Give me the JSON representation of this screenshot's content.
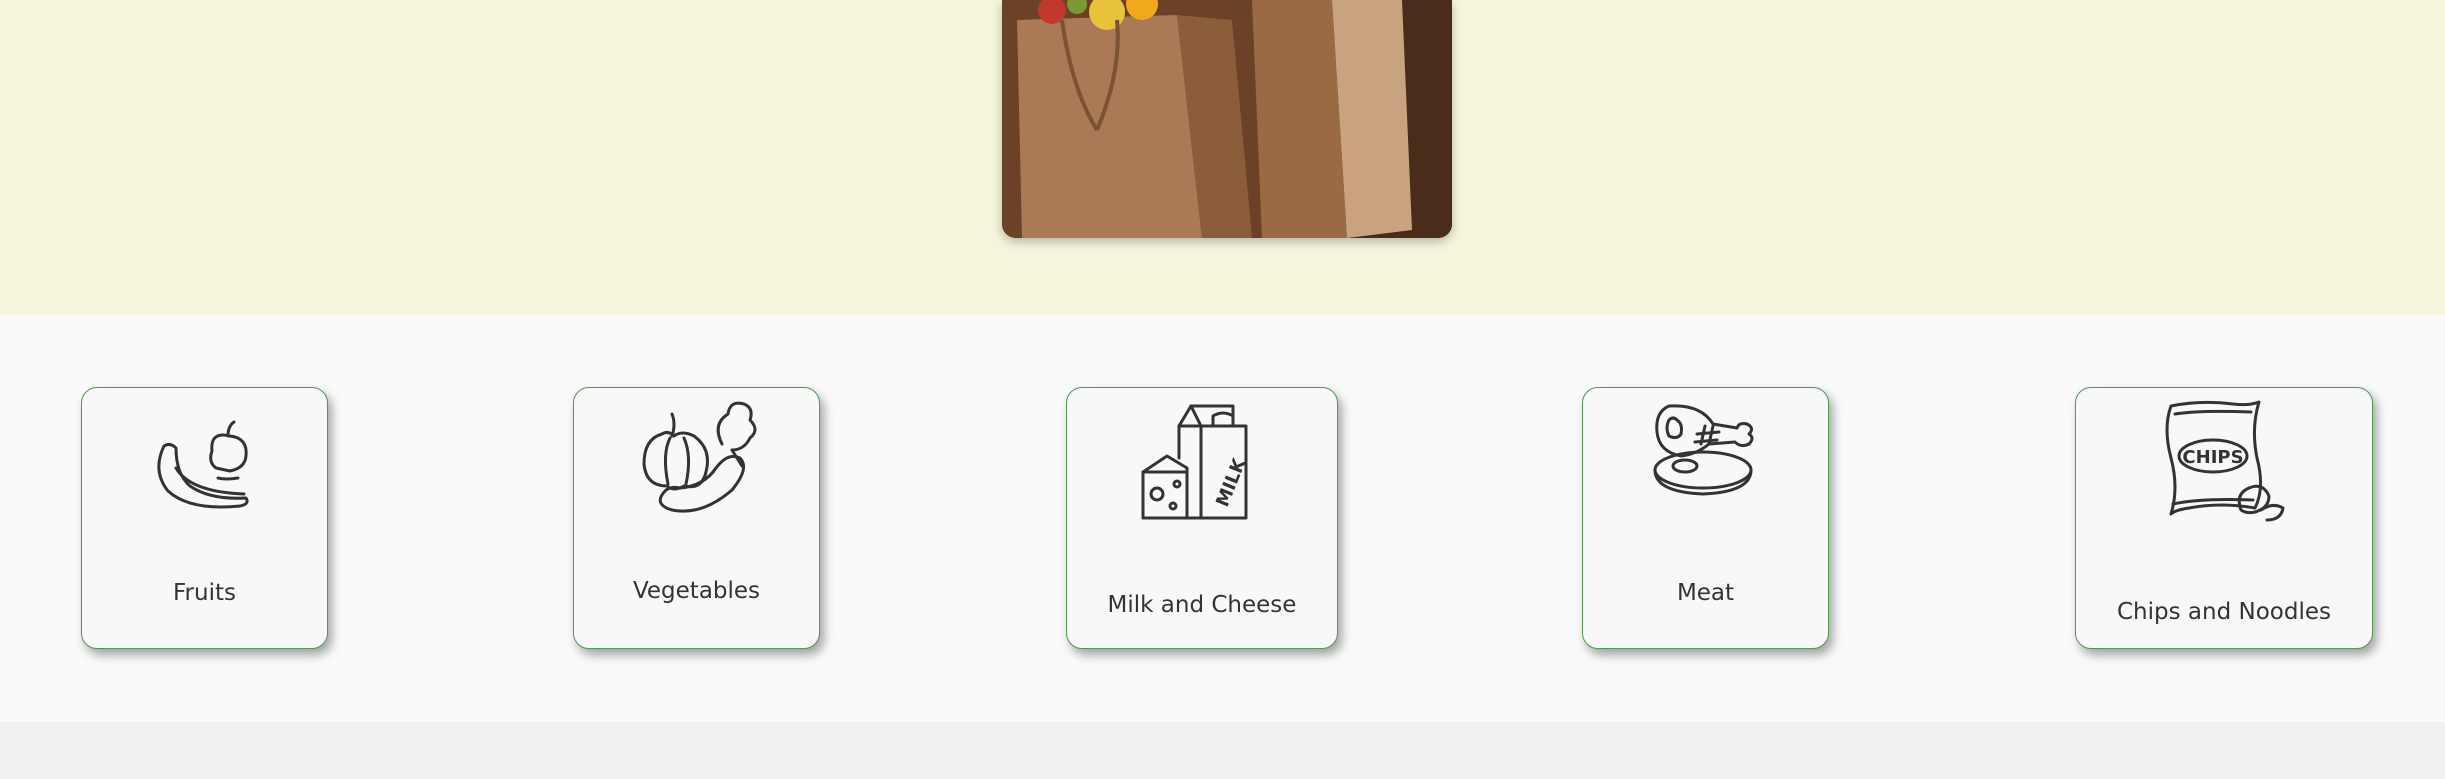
{
  "hero": {
    "image_icon": "grocery-bags-photo"
  },
  "categories": [
    {
      "label": "Fruits",
      "icon": "fruits-icon"
    },
    {
      "label": "Vegetables",
      "icon": "vegetables-icon"
    },
    {
      "label": "Milk and Cheese",
      "icon": "milk-cheese-icon"
    },
    {
      "label": "Meat",
      "icon": "meat-icon"
    },
    {
      "label": "Chips and Noodles",
      "icon": "chips-icon",
      "icon_text": "CHIPS"
    }
  ],
  "icon_text": {
    "milk": "MILK"
  },
  "colors": {
    "hero_bg": "#f5f5dc",
    "section_bg": "#fafafa",
    "card_border": "#4e9a4e"
  }
}
